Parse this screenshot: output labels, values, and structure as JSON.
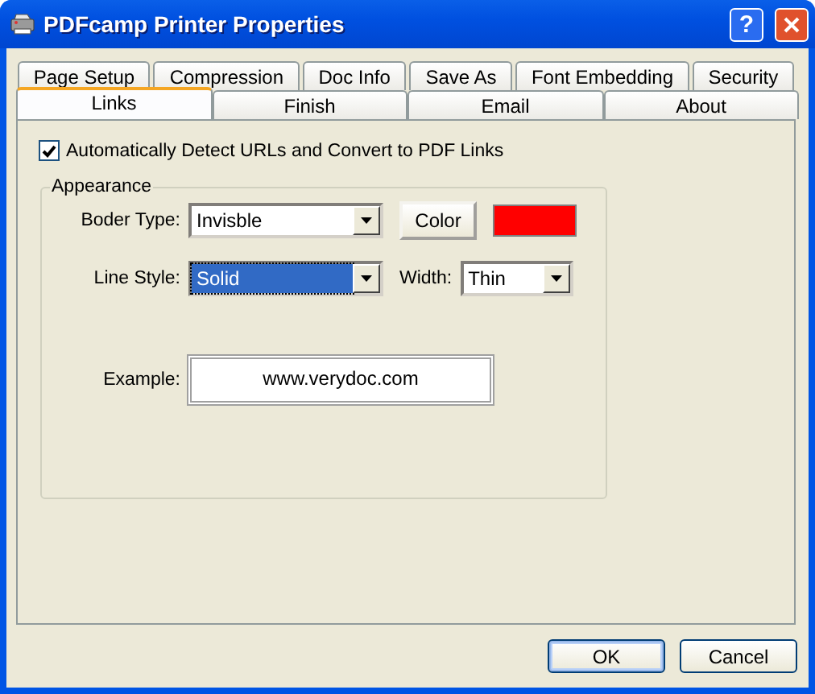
{
  "window": {
    "title": "PDFcamp Printer Properties",
    "help": "?"
  },
  "tab_rows": [
    {
      "tabs": [
        {
          "label": "Page Setup",
          "selected": false
        },
        {
          "label": "Compression",
          "selected": false
        },
        {
          "label": "Doc Info",
          "selected": false
        },
        {
          "label": "Save As",
          "selected": false
        },
        {
          "label": "Font Embedding",
          "selected": false
        },
        {
          "label": "Security",
          "selected": false
        }
      ]
    },
    {
      "tabs": [
        {
          "label": "Links",
          "selected": true
        },
        {
          "label": "Finish",
          "selected": false
        },
        {
          "label": "Email",
          "selected": false
        },
        {
          "label": "About",
          "selected": false
        }
      ]
    }
  ],
  "auto_detect": {
    "label": "Automatically Detect URLs and Convert to PDF Links",
    "checked": true
  },
  "appearance": {
    "title": "Appearance",
    "border_type": {
      "label": "Boder Type:",
      "value": "Invisble",
      "selected": false
    },
    "color_button": "Color",
    "color": "#ff0000",
    "line_style": {
      "label": "Line Style:",
      "value": "Solid",
      "selected": true
    },
    "width": {
      "label": "Width:",
      "value": "Thin",
      "selected": false
    },
    "example": {
      "label": "Example:",
      "value": "www.verydoc.com"
    }
  },
  "buttons": [
    {
      "label": "OK",
      "default": true
    },
    {
      "label": "Cancel",
      "default": false
    }
  ]
}
